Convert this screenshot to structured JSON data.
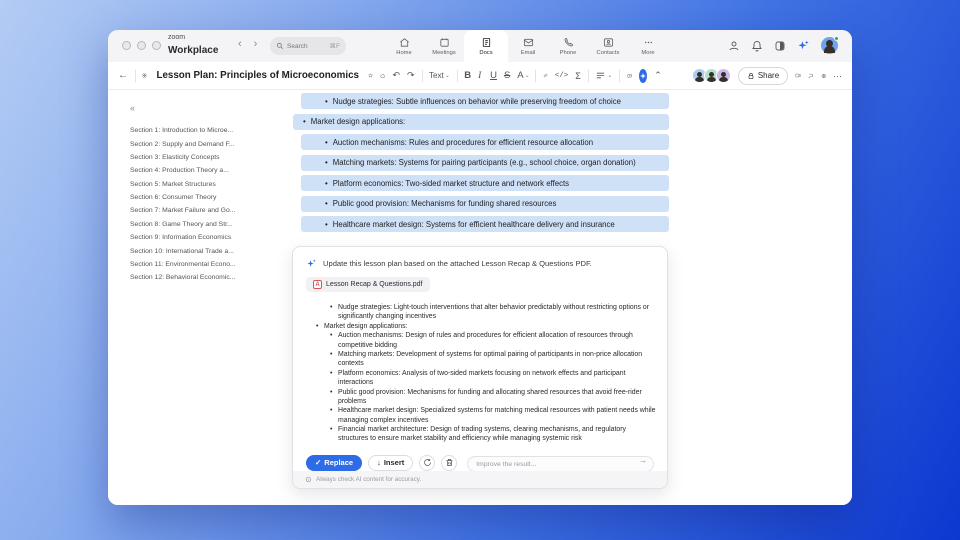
{
  "titlebar": {
    "brand_top": "zoom",
    "brand_bottom": "Workplace",
    "search": {
      "placeholder": "Search",
      "shortcut": "⌘F"
    },
    "tabs": [
      {
        "label": "Home"
      },
      {
        "label": "Meetings"
      },
      {
        "label": "Docs"
      },
      {
        "label": "Email"
      },
      {
        "label": "Phone"
      },
      {
        "label": "Contacts"
      },
      {
        "label": "More"
      }
    ]
  },
  "icons": {
    "back_arrow": "←",
    "nav_prev": "‹",
    "nav_next": "›",
    "undo": "↶",
    "redo": "↷",
    "sigma": "Σ",
    "code": "</>",
    "chevron_down": "⌄",
    "chevron_up": "⌃",
    "more_dots": "···",
    "collapse": "«",
    "bold": "B",
    "italic": "I",
    "underline": "U",
    "strike": "S",
    "text_color": "A",
    "check": "✓",
    "insert_down": "↓",
    "send_arrow": "→"
  },
  "toolbar": {
    "doc_title": "Lesson Plan: Principles of Microeconomics",
    "text_style_label": "Text",
    "share_label": "Share"
  },
  "sidebar": {
    "items": [
      "Section 1: Introduction to Microe...",
      "Section 2: Supply and Demand F...",
      "Section 3: Elasticity Concepts",
      "Section 4: Production Theory a...",
      "Section 5: Market Structures",
      "Section 6: Consumer Theory",
      "Section 7: Market Failure and Go...",
      "Section 8: Game Theory and Str...",
      "Section 9: Information Economics",
      "Section 10: International Trade a...",
      "Section 11: Environmental Econo...",
      "Section 12: Behavioral Economic..."
    ]
  },
  "document": {
    "rows": [
      {
        "level": "lv2",
        "text": "Nudge strategies: Subtle influences on behavior while preserving freedom of choice"
      },
      {
        "level": "lv1",
        "text": "Market design applications:"
      },
      {
        "level": "lv2",
        "text": "Auction mechanisms: Rules and procedures for efficient resource allocation"
      },
      {
        "level": "lv2",
        "text": "Matching markets: Systems for pairing participants (e.g., school choice, organ donation)"
      },
      {
        "level": "lv2",
        "text": "Platform economics: Two-sided market structure and network effects"
      },
      {
        "level": "lv2",
        "text": "Public good provision: Mechanisms for funding shared resources"
      },
      {
        "level": "lv2",
        "text": "Healthcare market design: Systems for efficient healthcare delivery and insurance"
      }
    ]
  },
  "ai_panel": {
    "prompt": "Update this lesson plan based on the attached Lesson Recap & Questions PDF.",
    "attachment_name": "Lesson Recap & Questions.pdf",
    "pdf_badge": "A",
    "bullets": [
      {
        "level": "lv2",
        "text": "Nudge strategies: Light-touch interventions that alter behavior predictably without restricting options or significantly changing incentives"
      },
      {
        "level": "lv1",
        "text": "Market design applications:"
      },
      {
        "level": "lv2",
        "text": "Auction mechanisms: Design of rules and procedures for efficient allocation of resources through competitive bidding"
      },
      {
        "level": "lv2",
        "text": "Matching markets: Development of systems for optimal pairing of participants in non-price allocation contexts"
      },
      {
        "level": "lv2",
        "text": "Platform economics: Analysis of two-sided markets focusing on network effects and participant interactions"
      },
      {
        "level": "lv2",
        "text": "Public good provision: Mechanisms for funding and allocating shared resources that avoid free-rider problems"
      },
      {
        "level": "lv2",
        "text": "Healthcare market design: Specialized systems for matching medical resources with patient needs while managing complex incentives"
      },
      {
        "level": "lv2",
        "text": "Financial market architecture: Design of trading systems, clearing mechanisms, and regulatory structures to ensure market stability and efficiency while managing systemic risk"
      }
    ],
    "replace_label": "Replace",
    "insert_label": "Insert",
    "input_placeholder": "Improve the result...",
    "footer_note": "Always check AI content for accuracy."
  },
  "colors": {
    "accent_blue": "#2e6be6",
    "highlight_blue": "#cfe1f7",
    "background_deep_blue": "#0d37d0"
  }
}
